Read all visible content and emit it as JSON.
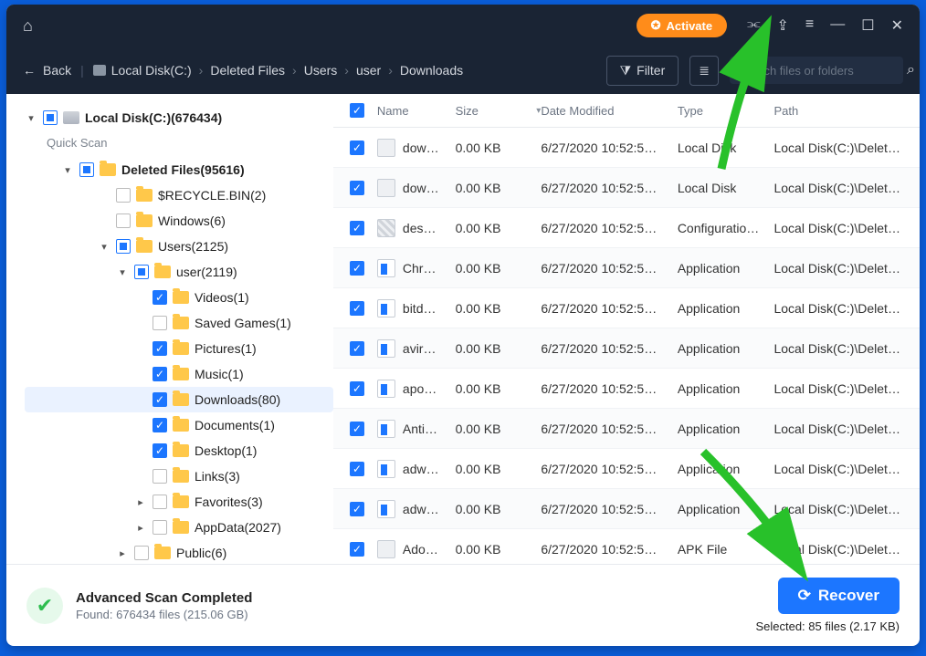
{
  "activate_label": "Activate",
  "back_label": "Back",
  "breadcrumb": [
    "Local Disk(C:)",
    "Deleted Files",
    "Users",
    "user",
    "Downloads"
  ],
  "filter_label": "Filter",
  "search_placeholder": "Search files or folders",
  "sidebar": {
    "root": "Local Disk(C:)(676434)",
    "quick_scan": "Quick Scan",
    "deleted": "Deleted Files(95616)",
    "items": [
      {
        "chev": "none",
        "check": "",
        "label": "$RECYCLE.BIN(2)"
      },
      {
        "chev": "none",
        "check": "",
        "label": "Windows(6)"
      },
      {
        "chev": "down",
        "check": "partial",
        "label": "Users(2125)"
      }
    ],
    "user": "user(2119)",
    "user_children": [
      {
        "check": "checked",
        "label": "Videos(1)"
      },
      {
        "check": "",
        "label": "Saved Games(1)"
      },
      {
        "check": "checked",
        "label": "Pictures(1)"
      },
      {
        "check": "checked",
        "label": "Music(1)"
      },
      {
        "check": "checked",
        "label": "Downloads(80)",
        "hl": true
      },
      {
        "check": "checked",
        "label": "Documents(1)"
      },
      {
        "check": "checked",
        "label": "Desktop(1)"
      },
      {
        "check": "",
        "label": "Links(3)"
      },
      {
        "check": "",
        "label": "Favorites(3)",
        "chev": "right"
      },
      {
        "check": "",
        "label": "AppData(2027)",
        "chev": "right"
      }
    ],
    "public": "Public(6)"
  },
  "columns": [
    "Name",
    "Size",
    "Date Modified",
    "Type",
    "Path"
  ],
  "rows": [
    {
      "ico": "",
      "name": "dow…",
      "size": "0.00 KB",
      "date": "6/27/2020 10:52:5…",
      "type": "Local Disk",
      "path": "Local Disk(C:)\\Delete…"
    },
    {
      "ico": "",
      "name": "dow…",
      "size": "0.00 KB",
      "date": "6/27/2020 10:52:5…",
      "type": "Local Disk",
      "path": "Local Disk(C:)\\Delete…"
    },
    {
      "ico": "cfg",
      "name": "des…",
      "size": "0.00 KB",
      "date": "6/27/2020 10:52:5…",
      "type": "Configuratio…",
      "path": "Local Disk(C:)\\Delete…"
    },
    {
      "ico": "app",
      "name": "Chr…",
      "size": "0.00 KB",
      "date": "6/27/2020 10:52:5…",
      "type": "Application",
      "path": "Local Disk(C:)\\Delete…"
    },
    {
      "ico": "app",
      "name": "bitd…",
      "size": "0.00 KB",
      "date": "6/27/2020 10:52:5…",
      "type": "Application",
      "path": "Local Disk(C:)\\Delete…"
    },
    {
      "ico": "app",
      "name": "avir…",
      "size": "0.00 KB",
      "date": "6/27/2020 10:52:5…",
      "type": "Application",
      "path": "Local Disk(C:)\\Delete…"
    },
    {
      "ico": "app",
      "name": "apo…",
      "size": "0.00 KB",
      "date": "6/27/2020 10:52:5…",
      "type": "Application",
      "path": "Local Disk(C:)\\Delete…"
    },
    {
      "ico": "app",
      "name": "Anti…",
      "size": "0.00 KB",
      "date": "6/27/2020 10:52:5…",
      "type": "Application",
      "path": "Local Disk(C:)\\Delete…"
    },
    {
      "ico": "app",
      "name": "adw…",
      "size": "0.00 KB",
      "date": "6/27/2020 10:52:5…",
      "type": "Application",
      "path": "Local Disk(C:)\\Delete…"
    },
    {
      "ico": "app",
      "name": "adw…",
      "size": "0.00 KB",
      "date": "6/27/2020 10:52:5…",
      "type": "Application",
      "path": "Local Disk(C:)\\Delete…"
    },
    {
      "ico": "",
      "name": "Ado…",
      "size": "0.00 KB",
      "date": "6/27/2020 10:52:5…",
      "type": "APK File",
      "path": "Local Disk(C:)\\Delete…"
    }
  ],
  "status": {
    "title": "Advanced Scan Completed",
    "found": "Found: 676434 files (215.06 GB)"
  },
  "recover_label": "Recover",
  "selected_label": "Selected: 85 files (2.17 KB)"
}
